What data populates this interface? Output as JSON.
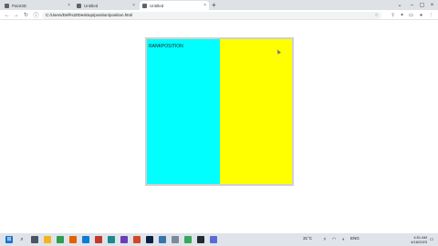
{
  "browser": {
    "tabs": [
      {
        "title": "Paint3D",
        "active": false
      },
      {
        "title": "Untitled",
        "active": false
      },
      {
        "title": "Untitled",
        "active": true
      }
    ],
    "new_tab_symbol": "+",
    "close_symbol": "×",
    "address": "C:/Users/Dell%20Desktop/position/position.html",
    "window_controls": {
      "minimize": "–",
      "maximize": "▢",
      "close": "×"
    }
  },
  "page": {
    "box_label": "RANKPOSITION",
    "colors": {
      "cyan": "#00ffff",
      "yellow": "#ffff00",
      "frame": "#d0d0d0"
    }
  },
  "taskbar": {
    "icons": [
      "windows-icon",
      "search-icon",
      "task-view-icon",
      "file-explorer-icon",
      "chrome-icon",
      "firefox-icon",
      "photos-icon",
      "calendar-icon",
      "edge-icon",
      "visual-studio-icon",
      "office-icon",
      "photoshop-icon",
      "python-icon",
      "notepad-icon",
      "camtasia-icon",
      "terminal-icon",
      "store-icon"
    ],
    "weather": "31°C",
    "language": "ENG",
    "time": "4:51 AM",
    "date": "4/18/2023"
  }
}
